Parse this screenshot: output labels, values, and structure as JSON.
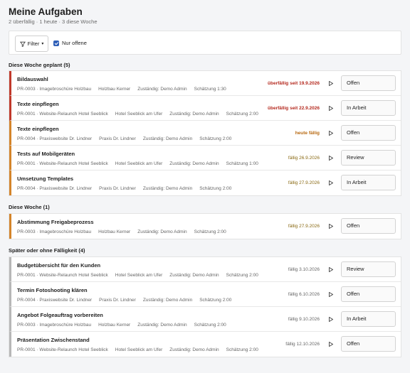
{
  "header": {
    "title": "Meine Aufgaben",
    "subtitle": "2 überfällig · 1 heute · 3 diese Woche"
  },
  "filters": {
    "filter_label": "Filter",
    "only_open_label": "Nur offene",
    "only_open_checked": true
  },
  "sections": [
    {
      "title": "Diese Woche geplant (5)",
      "tasks": [
        {
          "title": "Bildauswahl",
          "project": "PR-0003 · Imagebroschüre Holzbau",
          "client": "Holzbau Kerner",
          "assignee": "Zuständig: Demo Admin",
          "estimate": "Schätzung 1:30",
          "due": "überfällig seit 19.9.2026",
          "due_style": "red",
          "status": "Offen"
        },
        {
          "title": "Texte einpflegen",
          "project": "PR-0001 · Website-Relaunch Hotel Seeblick",
          "client": "Hotel Seeblick am Ufer",
          "assignee": "Zuständig: Demo Admin",
          "estimate": "Schätzung 2:00",
          "due": "überfällig seit 22.9.2026",
          "due_style": "red",
          "status": "In Arbeit"
        },
        {
          "title": "Texte einpflegen",
          "project": "PR-0004 · Praxiswebsite Dr. Lindner",
          "client": "Praxis Dr. Lindner",
          "assignee": "Zuständig: Demo Admin",
          "estimate": "Schätzung 2:00",
          "due": "heute fällig",
          "due_style": "orange",
          "status": "Offen"
        },
        {
          "title": "Tests auf Mobilgeräten",
          "project": "PR-0001 · Website-Relaunch Hotel Seeblick",
          "client": "Hotel Seeblick am Ufer",
          "assignee": "Zuständig: Demo Admin",
          "estimate": "Schätzung 1:00",
          "due": "fällig 26.9.2026",
          "due_style": "olive",
          "status": "Review"
        },
        {
          "title": "Umsetzung Templates",
          "project": "PR-0004 · Praxiswebsite Dr. Lindner",
          "client": "Praxis Dr. Lindner",
          "assignee": "Zuständig: Demo Admin",
          "estimate": "Schätzung 2:00",
          "due": "fällig 27.9.2026",
          "due_style": "olive",
          "status": "In Arbeit"
        }
      ]
    },
    {
      "title": "Diese Woche (1)",
      "tasks": [
        {
          "title": "Abstimmung Freigabeprozess",
          "project": "PR-0003 · Imagebroschüre Holzbau",
          "client": "Holzbau Kerner",
          "assignee": "Zuständig: Demo Admin",
          "estimate": "Schätzung 2:00",
          "due": "fällig 27.9.2026",
          "due_style": "olive",
          "status": "Offen"
        }
      ]
    },
    {
      "title": "Später oder ohne Fälligkeit (4)",
      "tasks": [
        {
          "title": "Budgetübersicht für den Kunden",
          "project": "PR-0001 · Website-Relaunch Hotel Seeblick",
          "client": "Hotel Seeblick am Ufer",
          "assignee": "Zuständig: Demo Admin",
          "estimate": "Schätzung 2:00",
          "due": "fällig 3.10.2026",
          "due_style": "gray",
          "status": "Review"
        },
        {
          "title": "Termin Fotoshooting klären",
          "project": "PR-0004 · Praxiswebsite Dr. Lindner",
          "client": "Praxis Dr. Lindner",
          "assignee": "Zuständig: Demo Admin",
          "estimate": "Schätzung 2:00",
          "due": "fällig 6.10.2026",
          "due_style": "gray",
          "status": "Offen"
        },
        {
          "title": "Angebot Folgeauftrag vorbereiten",
          "project": "PR-0003 · Imagebroschüre Holzbau",
          "client": "Holzbau Kerner",
          "assignee": "Zuständig: Demo Admin",
          "estimate": "Schätzung 2:00",
          "due": "fällig 9.10.2026",
          "due_style": "gray",
          "status": "In Arbeit"
        },
        {
          "title": "Präsentation Zwischenstand",
          "project": "PR-0001 · Website-Relaunch Hotel Seeblick",
          "client": "Hotel Seeblick am Ufer",
          "assignee": "Zuständig: Demo Admin",
          "estimate": "Schätzung 2:00",
          "due": "fällig 12.10.2026",
          "due_style": "gray",
          "status": "Offen"
        }
      ]
    }
  ],
  "colors": {
    "overdue": "#c0392b",
    "today": "#d4842a",
    "upcoming": "#b7b7b7",
    "checkbox": "#2e5fb8"
  },
  "icons": {
    "filter": "filter-icon",
    "play": "play-icon"
  }
}
